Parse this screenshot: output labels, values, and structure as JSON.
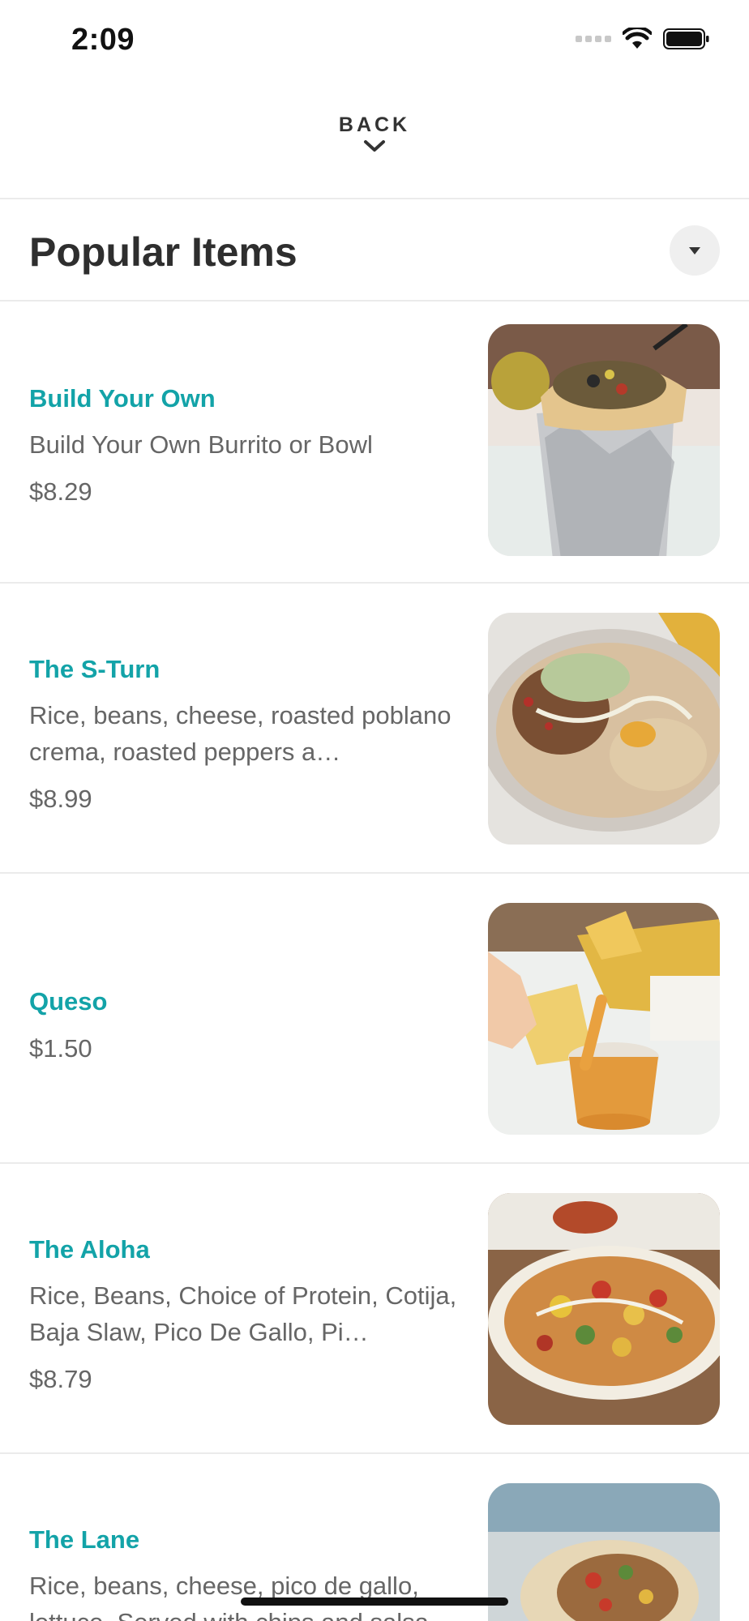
{
  "status_bar": {
    "time": "2:09"
  },
  "header": {
    "back_label": "BACK"
  },
  "section": {
    "title": "Popular Items"
  },
  "items": [
    {
      "name": "Build Your Own",
      "description": "Build Your Own Burrito or Bowl",
      "price": "$8.29"
    },
    {
      "name": "The S-Turn",
      "description": "Rice, beans, cheese, roasted poblano crema, roasted peppers a…",
      "price": "$8.99"
    },
    {
      "name": "Queso",
      "description": "",
      "price": "$1.50"
    },
    {
      "name": "The Aloha",
      "description": "Rice, Beans, Choice of Protein, Cotija, Baja Slaw, Pico De Gallo, Pi…",
      "price": "$8.79"
    },
    {
      "name": "The Lane",
      "description": "Rice, beans, cheese, pico de gallo, lettuce. Served with chips and salsa.",
      "price": ""
    }
  ],
  "icons": {
    "back": "chevron-down-icon",
    "collapse": "triangle-down-icon"
  },
  "colors": {
    "accent": "#13a3a8",
    "text": "#333333",
    "muted": "#666666",
    "divider": "#ebebeb"
  }
}
